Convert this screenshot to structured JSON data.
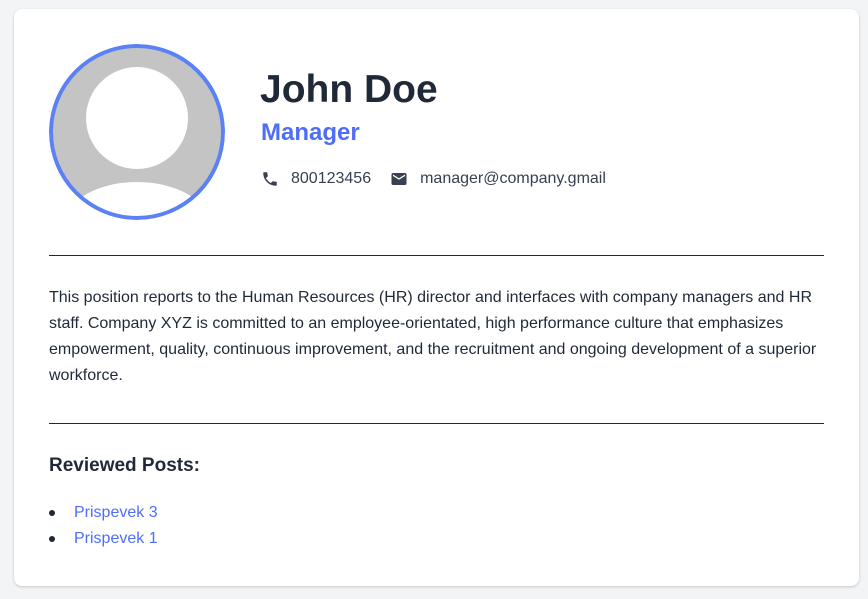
{
  "profile": {
    "name": "John Doe",
    "role": "Manager",
    "phone": "800123456",
    "email": "manager@company.gmail",
    "avatar_icon": "user-avatar-placeholder"
  },
  "description": "This position reports to the Human Resources (HR) director and interfaces with company managers and HR staff. Company XYZ is committed to an employee-orientated, high performance culture that emphasizes empowerment, quality, continuous improvement, and the recruitment and ongoing development of a superior workforce.",
  "posts": {
    "title": "Reviewed Posts:",
    "items": [
      {
        "label": "Prispevek 3"
      },
      {
        "label": "Prispevek 1"
      }
    ]
  },
  "colors": {
    "accent": "#4f6ef7",
    "text": "#1f2937",
    "avatar_bg": "#c4c4c4",
    "avatar_ring": "#5b82f5"
  },
  "icons": {
    "phone": "phone-icon",
    "email": "envelope-icon"
  }
}
